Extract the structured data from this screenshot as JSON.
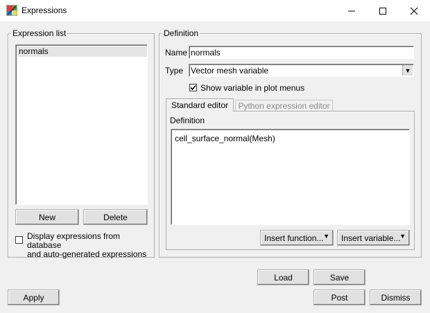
{
  "window": {
    "title": "Expressions"
  },
  "expression_list": {
    "title": "Expression list",
    "items": [
      "normals"
    ],
    "new_label": "New",
    "delete_label": "Delete",
    "display_checkbox_label": "Display expressions from database and auto-generated expressions",
    "display_checkbox_line1": "Display expressions from database",
    "display_checkbox_line2": "and auto-generated expressions",
    "display_checked": false
  },
  "definition": {
    "title": "Definition",
    "name_label": "Name",
    "name_value": "normals",
    "type_label": "Type",
    "type_value": "Vector mesh variable",
    "show_var_label": "Show variable in plot menus",
    "show_var_checked": true,
    "tabs": [
      {
        "label": "Standard editor",
        "active": true
      },
      {
        "label": "Python expression editor",
        "active": false
      }
    ],
    "editor_label": "Definition",
    "editor_text": "cell_surface_normal(Mesh)",
    "insert_function_label": "Insert function...",
    "insert_variable_label": "Insert variable..."
  },
  "footer": {
    "load_label": "Load",
    "save_label": "Save",
    "apply_label": "Apply",
    "post_label": "Post",
    "dismiss_label": "Dismiss"
  }
}
